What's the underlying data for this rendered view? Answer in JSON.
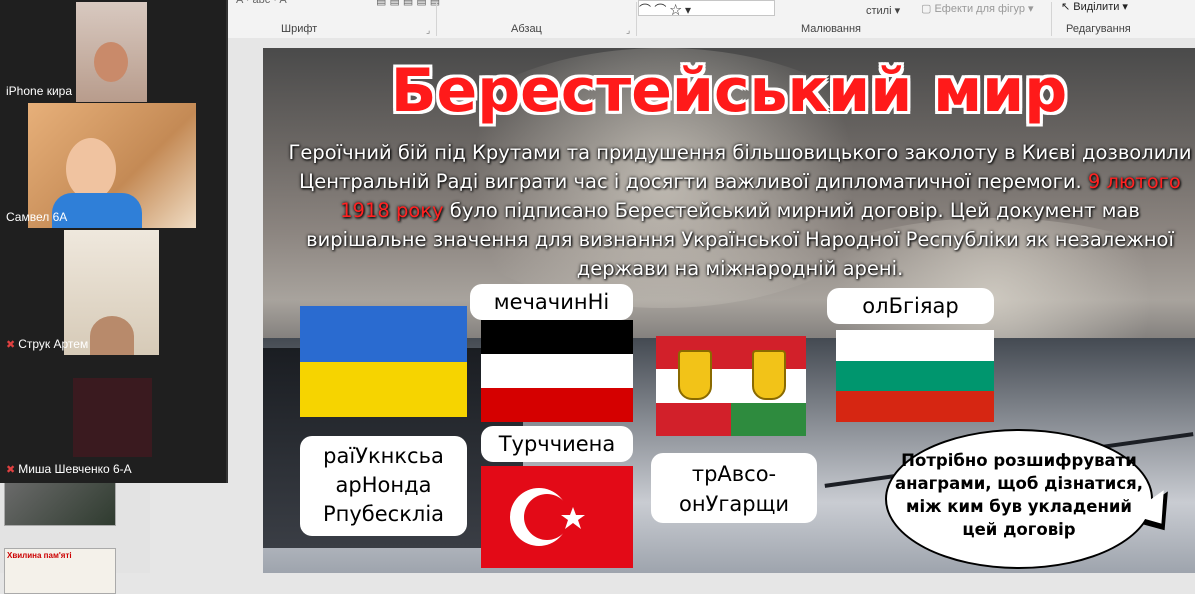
{
  "ribbon": {
    "groups": {
      "font": "Шрифт",
      "paragraph": "Абзац",
      "drawing": "Малювання",
      "editing": "Редагування"
    },
    "styles_label": "стилі",
    "shape_effects_label": "Ефекти для фігур",
    "select_label": "Виділити"
  },
  "video": {
    "participants": [
      {
        "name": "iPhone кира",
        "muted": false
      },
      {
        "name": "Самвел 6А",
        "muted": false
      },
      {
        "name": "Струк Артем",
        "muted": true
      },
      {
        "name": "Миша Шевченко 6-А",
        "muted": true
      }
    ]
  },
  "thumbnails": {
    "thumb2_title": "Хвилина пам'яті"
  },
  "slide": {
    "title": "Берестейський мир",
    "body_part1": "Героїчний бій під Крутами та придушення більшовицького заколоту в Києві дозволили Центральній Раді виграти час і досягти важливої дипломатичної перемоги. ",
    "body_highlight": "9 лютого 1918 року",
    "body_part2": " було підписано Берестейський мирний договір. Цей документ мав вирішальне значення для визнання Української Народної Республіки як незалежної держави на міжнародній арені.",
    "highlight_color": "#ff2222",
    "labels": {
      "ukraine": [
        "раїУкнксьа",
        "арНонда",
        "Рпубескліа"
      ],
      "germany": "мечачинНі",
      "turkey": "Турччиена",
      "austria": [
        "трАвсо-",
        "онУгарщи"
      ],
      "bulgaria": "олБгіяар"
    },
    "bubble_text": "Потрібно розшифрувати анаграми, щоб дізнатися, між ким був укладений цей договір"
  }
}
